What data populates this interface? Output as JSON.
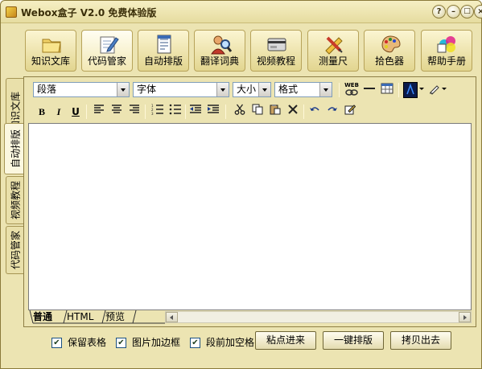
{
  "window": {
    "title": "Webox盒子 V2.0  免费体验版"
  },
  "title_buttons": [
    "?",
    "–",
    "□",
    "×"
  ],
  "toolbar": {
    "items": [
      {
        "label": "知识文库",
        "icon": "folder-icon"
      },
      {
        "label": "代码管家",
        "icon": "pen-paper-icon"
      },
      {
        "label": "自动排版",
        "icon": "document-icon"
      },
      {
        "label": "翻译词典",
        "icon": "person-magnifier-icon"
      },
      {
        "label": "视频教程",
        "icon": "video-card-icon"
      },
      {
        "label": "测量尺",
        "icon": "ruler-pencil-icon"
      },
      {
        "label": "拾色器",
        "icon": "palette-icon"
      },
      {
        "label": "帮助手册",
        "icon": "help-colors-icon"
      }
    ]
  },
  "side_tabs": [
    "知识文库",
    "自动排版",
    "视频教程",
    "代码管家"
  ],
  "format_bar": {
    "paragraph": "段落",
    "font": "字体",
    "size": "大小",
    "style": "格式",
    "web_label": "WEB"
  },
  "format_buttons": {
    "bold": "B",
    "italic": "I",
    "underline": "U"
  },
  "editor": {
    "content": ""
  },
  "bottom_tabs": [
    "普通",
    "HTML",
    "预览"
  ],
  "options": [
    {
      "label": "保留表格",
      "checked": true
    },
    {
      "label": "图片加边框",
      "checked": true
    },
    {
      "label": "段前加空格",
      "checked": true
    }
  ],
  "actions": {
    "paste": "粘点进来",
    "format": "一键排版",
    "copy_out": "拷贝出去"
  },
  "colors": {
    "window_bg": "#ece4b2",
    "editor_bg": "#ffffff",
    "accent_blue": "#1c5180"
  }
}
